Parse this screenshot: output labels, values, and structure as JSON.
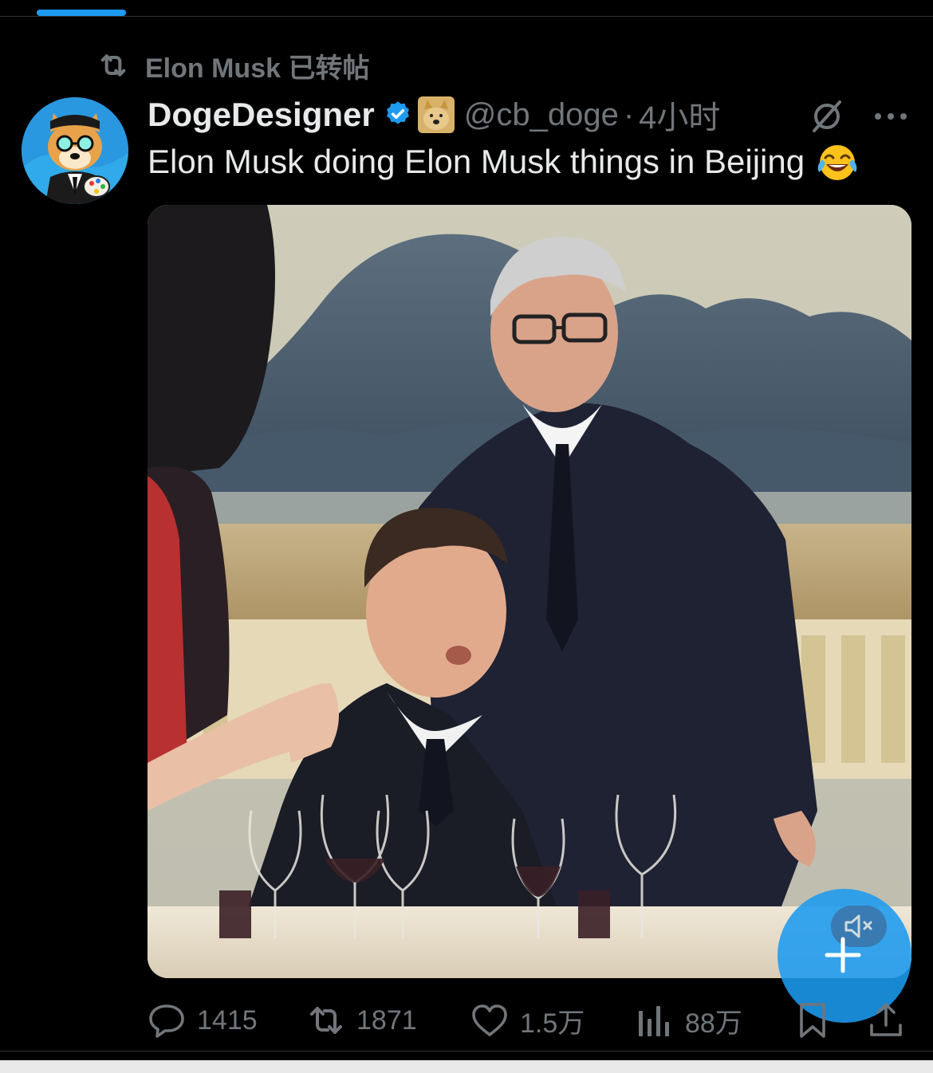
{
  "repost": {
    "label": "Elon Musk 已转帖",
    "icon": "repost-icon"
  },
  "tweet": {
    "display_name": "DogeDesigner",
    "handle": "@cb_doge",
    "separator": "·",
    "time": "4小时",
    "text": "Elon Musk doing Elon Musk things in Beijing",
    "text_emoji": "face-with-tears-of-joy-emoji",
    "verified_color": "#1d9bf0"
  },
  "actions": {
    "replies": "1415",
    "reposts": "1871",
    "likes": "1.5万",
    "views": "88万"
  },
  "colors": {
    "background": "#000000",
    "text_primary": "#e7e9ea",
    "text_secondary": "#71767b",
    "accent": "#1d9bf0"
  }
}
